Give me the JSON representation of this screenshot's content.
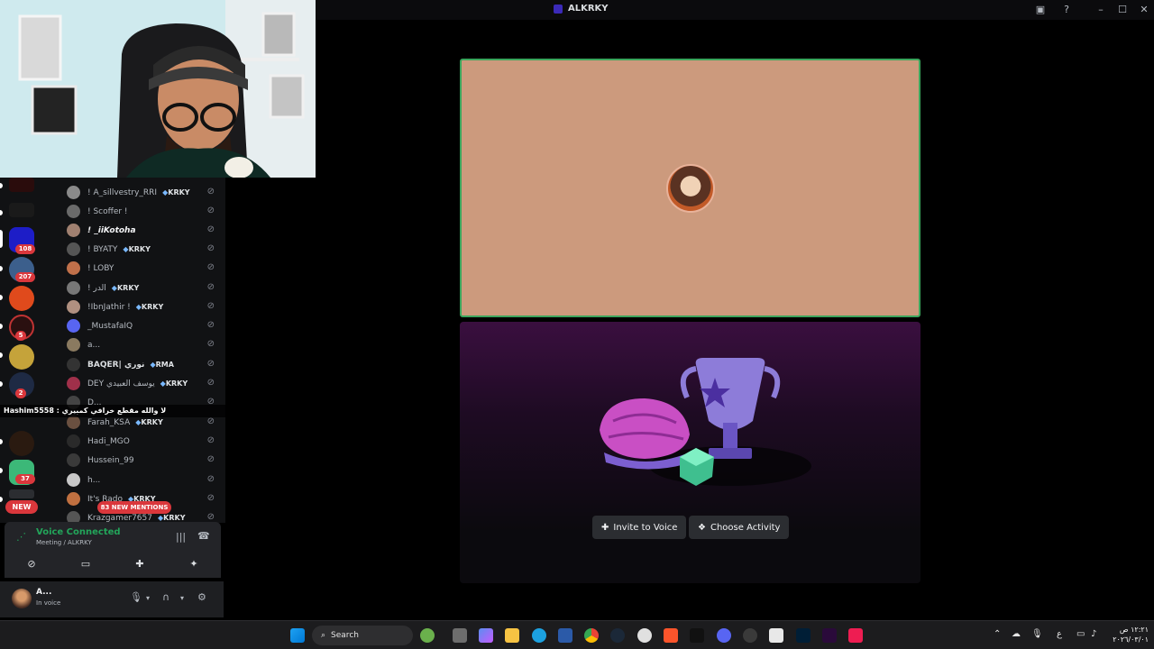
{
  "window": {
    "title": "ALKRKY"
  },
  "member_list": [
    {
      "name": "! A_sillvestry_RRI",
      "tag": "KRKY"
    },
    {
      "name": "! Scoffer !",
      "tag": ""
    },
    {
      "name": "! _iiKotoha",
      "tag": ""
    },
    {
      "name": "! BYATY",
      "tag": "KRKY"
    },
    {
      "name": "! LOBY",
      "tag": ""
    },
    {
      "name": "! الدر",
      "tag": "KRKY"
    },
    {
      "name": "!IbnJathir !",
      "tag": "KRKY"
    },
    {
      "name": "_MustafaIQ",
      "tag": ""
    },
    {
      "name": "a...",
      "tag": ""
    },
    {
      "name": "BAQER| نوري",
      "tag": "RMA"
    },
    {
      "name": "DEY يوسف العبيدي",
      "tag": "KRKY"
    },
    {
      "name": "D...",
      "tag": ""
    },
    {
      "name": "Farah_KSA",
      "tag": "KRKY"
    },
    {
      "name": "Hadi_MGO",
      "tag": ""
    },
    {
      "name": "Hussein_99",
      "tag": ""
    },
    {
      "name": "h...",
      "tag": ""
    },
    {
      "name": "It's Rado",
      "tag": "KRKY"
    },
    {
      "name": "Krazgamer7657",
      "tag": "KRKY"
    }
  ],
  "server_badges": [
    "108",
    "207",
    "5",
    "2",
    "37"
  ],
  "new_badge": "NEW",
  "mentions_badge": "83 NEW MENTIONS",
  "chat_overlay": "Hashim5558 : لا والله مقطع خرافي كمبيري",
  "voice": {
    "status": "Voice Connected",
    "channel": "Meeting / ALKRKY"
  },
  "user": {
    "name": "A...",
    "status": "In voice"
  },
  "activity": {
    "invite_label": "Invite to Voice",
    "choose_label": "Choose Activity"
  },
  "taskbar": {
    "search_placeholder": "Search",
    "time": "١٢:٢١ ص",
    "date": "٢٠٢٦/٠٣/٠١",
    "lang": "ع"
  }
}
